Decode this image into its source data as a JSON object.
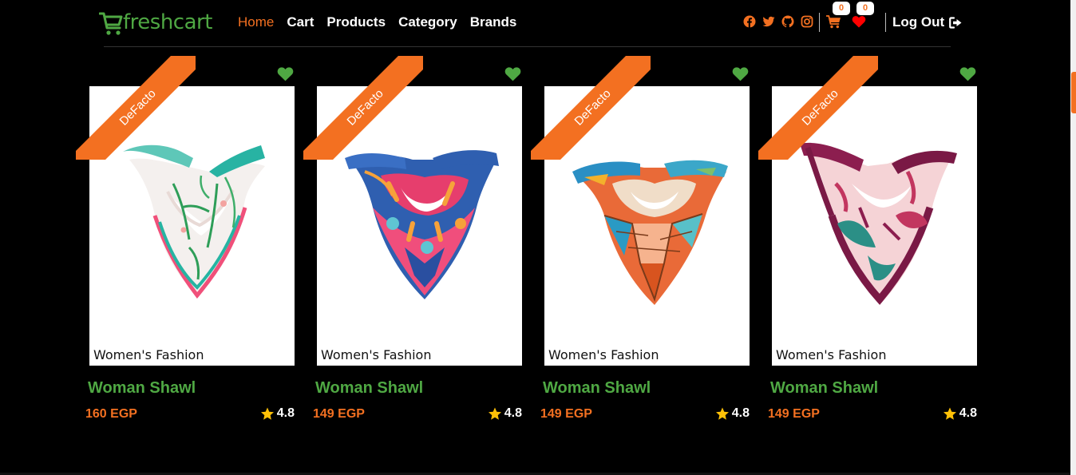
{
  "brand": {
    "logo_text": "freshcart"
  },
  "nav": {
    "links": [
      {
        "label": "Home",
        "active": true
      },
      {
        "label": "Cart",
        "active": false
      },
      {
        "label": "Products",
        "active": false
      },
      {
        "label": "Category",
        "active": false
      },
      {
        "label": "Brands",
        "active": false
      }
    ],
    "social_icons": [
      "facebook-icon",
      "twitter-icon",
      "github-icon",
      "instagram-icon"
    ],
    "cart_count": "0",
    "wishlist_count": "0",
    "logout_label": "Log Out"
  },
  "colors": {
    "accent": "#f37021",
    "brand_green": "#4fa843",
    "wishlist_red": "#ff0000",
    "star": "#ffc107",
    "background": "#000000"
  },
  "products": [
    {
      "brand": "DeFacto",
      "category": "Women's Fashion",
      "title": "Woman Shawl",
      "price": "160 EGP",
      "rating": "4.8",
      "image": "white-green-floral-scarf"
    },
    {
      "brand": "DeFacto",
      "category": "Women's Fashion",
      "title": "Woman Shawl",
      "price": "149 EGP",
      "rating": "4.8",
      "image": "blue-pink-abstract-scarf"
    },
    {
      "brand": "DeFacto",
      "category": "Women's Fashion",
      "title": "Woman Shawl",
      "price": "149 EGP",
      "rating": "4.8",
      "image": "orange-teal-geometric-scarf"
    },
    {
      "brand": "DeFacto",
      "category": "Women's Fashion",
      "title": "Woman Shawl",
      "price": "149 EGP",
      "rating": "4.8",
      "image": "purple-pink-leaf-scarf"
    }
  ]
}
